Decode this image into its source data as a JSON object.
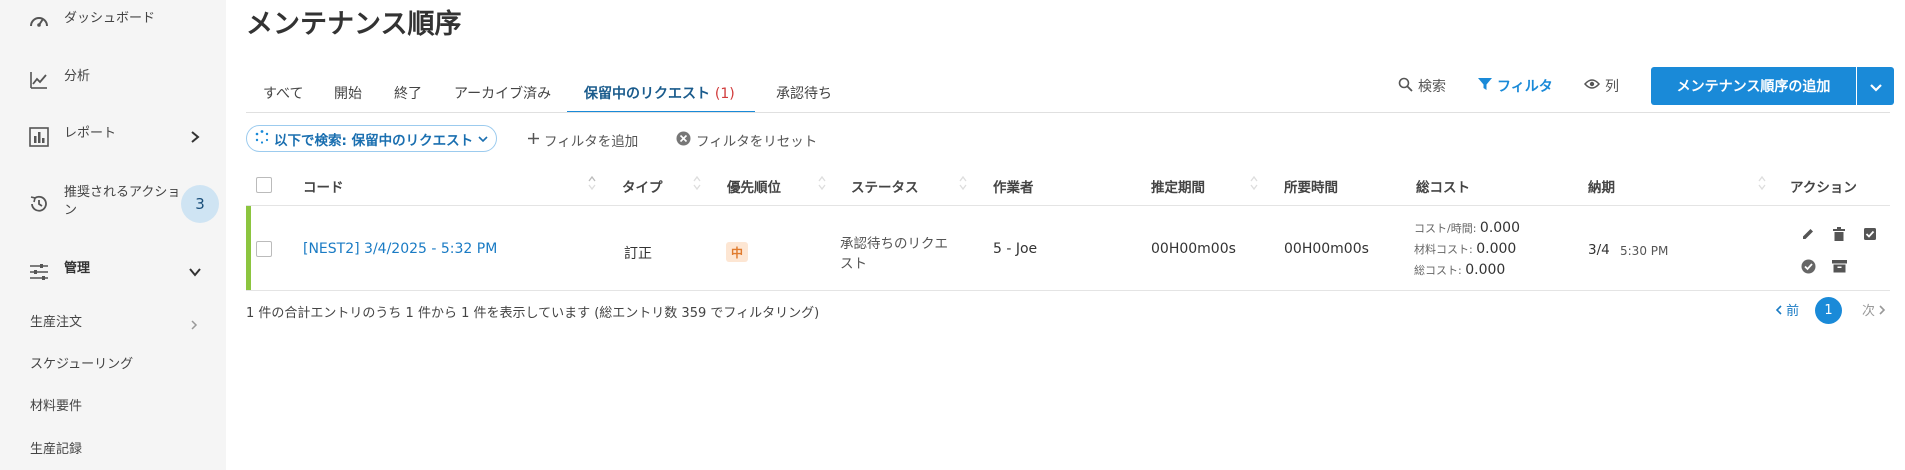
{
  "sidebar": {
    "items": [
      {
        "label": "ダッシュボード",
        "icon": "speedometer-icon"
      },
      {
        "label": "分析",
        "icon": "chart-line-icon"
      },
      {
        "label": "レポート",
        "icon": "bar-chart-icon"
      },
      {
        "label": "推奨されるアクション",
        "icon": "history-icon",
        "badge": "3"
      },
      {
        "label": "管理",
        "icon": "sliders-icon"
      }
    ],
    "sub_items": [
      "生産注文",
      "スケジューリング",
      "材料要件",
      "生産記録"
    ]
  },
  "page": {
    "title": "メンテナンス順序"
  },
  "tabs": [
    {
      "label": "すべて"
    },
    {
      "label": "開始"
    },
    {
      "label": "終了"
    },
    {
      "label": "アーカイブ済み"
    },
    {
      "label": "保留中のリクエスト",
      "count": "(1)",
      "active": true
    },
    {
      "label": "承認待ち"
    }
  ],
  "toolbar": {
    "search_label": "検索",
    "filter_label": "フィルタ",
    "columns_label": "列",
    "add_label": "メンテナンス順序の追加"
  },
  "filters": {
    "chip_label": "以下で検索: 保留中のリクエスト",
    "add_filter_label": "フィルタを追加",
    "reset_filter_label": "フィルタをリセット"
  },
  "table": {
    "headers": {
      "code": "コード",
      "type": "タイプ",
      "priority": "優先順位",
      "status": "ステータス",
      "worker": "作業者",
      "estimated": "推定期間",
      "required": "所要時間",
      "total_cost": "総コスト",
      "due": "納期",
      "actions": "アクション"
    },
    "rows": [
      {
        "code": "[NEST2] 3/4/2025 - 5:32 PM",
        "type": "訂正",
        "priority": "中",
        "status_line1": "承認待ちのリクエ",
        "status_line2": "スト",
        "worker": "5 - Joe",
        "estimated": "00H00m00s",
        "required": "00H00m00s",
        "cost_per_hour_label": "コスト/時間:",
        "cost_per_hour": "0.000",
        "material_cost_label": "材料コスト:",
        "material_cost": "0.000",
        "total_cost_label": "総コスト:",
        "total_cost": "0.000",
        "due_date": "3/4",
        "due_time": "5:30 PM",
        "accent_color": "#8cc53f"
      }
    ]
  },
  "footer": {
    "summary": "1 件の合計エントリのうち 1 件から 1 件を表示しています (総エントリ数 359 でフィルタリング)",
    "prev": "前",
    "page": "1",
    "next": "次"
  },
  "colors": {
    "accent": "#1a8ad8",
    "sidebar_bg": "#f5f5f5",
    "badge_bg": "#cfe4f3",
    "tab_count": "#d13b3b",
    "priority_bg": "#fde6d3",
    "priority_text": "#e07b2e"
  }
}
